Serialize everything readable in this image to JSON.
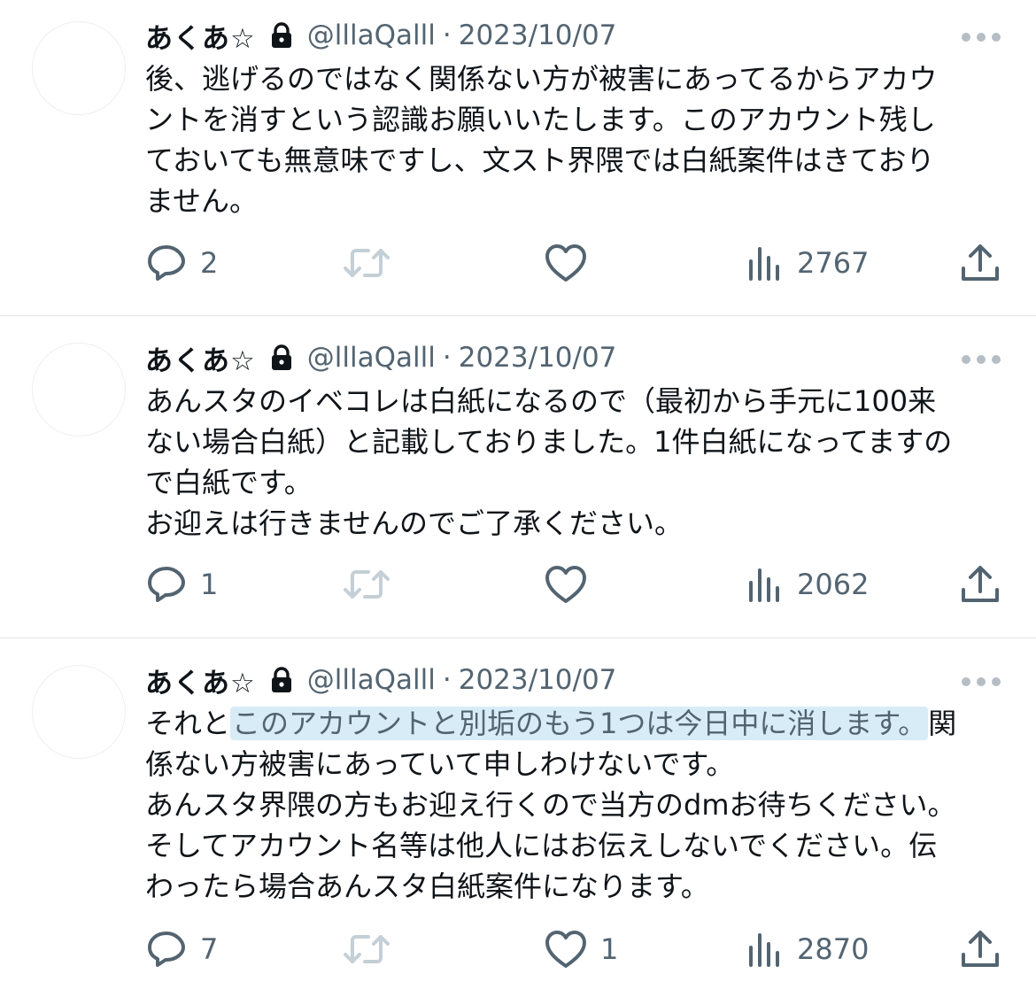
{
  "tweets": [
    {
      "name": "あくあ☆",
      "handle": "@lllaQalll",
      "separator": "·",
      "date": "2023/10/07",
      "lines": [
        "後、逃げるのではなく関係ない方が被害にあってるからアカウ",
        "ントを消すという認識お願いいたします。このアカウント残し",
        "ておいても無意味ですし、文スト界隈では白紙案件はきており",
        "ません。"
      ],
      "replies": "2",
      "likes": "",
      "views": "2767"
    },
    {
      "name": "あくあ☆",
      "handle": "@lllaQalll",
      "separator": "·",
      "date": "2023/10/07",
      "lines": [
        "あんスタのイベコレは白紙になるので（最初から手元に100来",
        "ない場合白紙）と記載しておりました。1件白紙になってますの",
        "で白紙です。",
        "お迎えは行きませんのでご了承ください。"
      ],
      "replies": "1",
      "likes": "",
      "views": "2062"
    },
    {
      "name": "あくあ☆",
      "handle": "@lllaQalll",
      "separator": "·",
      "date": "2023/10/07",
      "line1_pre": "それと",
      "line1_highlight": "このアカウントと別垢のもう1つは今日中に消します。",
      "line1_post": "関",
      "lines": [
        "係ない方被害にあっていて申しわけないです。",
        "あんスタ界隈の方もお迎え行くので当方のdmお待ちください。",
        "そしてアカウント名等は他人にはお伝えしないでください。伝",
        "わったら場合あんスタ白紙案件になります。"
      ],
      "replies": "7",
      "likes": "1",
      "views": "2870"
    }
  ],
  "colors": {
    "text": "#0f1419",
    "secondary": "#536471",
    "retweet_disabled": "#c4cfd6",
    "highlight_bg": "#d8ecf8",
    "divider": "#e1e6ea"
  },
  "icons": {
    "reply": "speech-bubble",
    "retweet": "retweet-arrows",
    "like": "heart",
    "views": "bar-chart",
    "share": "upload-arrow",
    "lock": "padlock",
    "more": "three-dots"
  }
}
